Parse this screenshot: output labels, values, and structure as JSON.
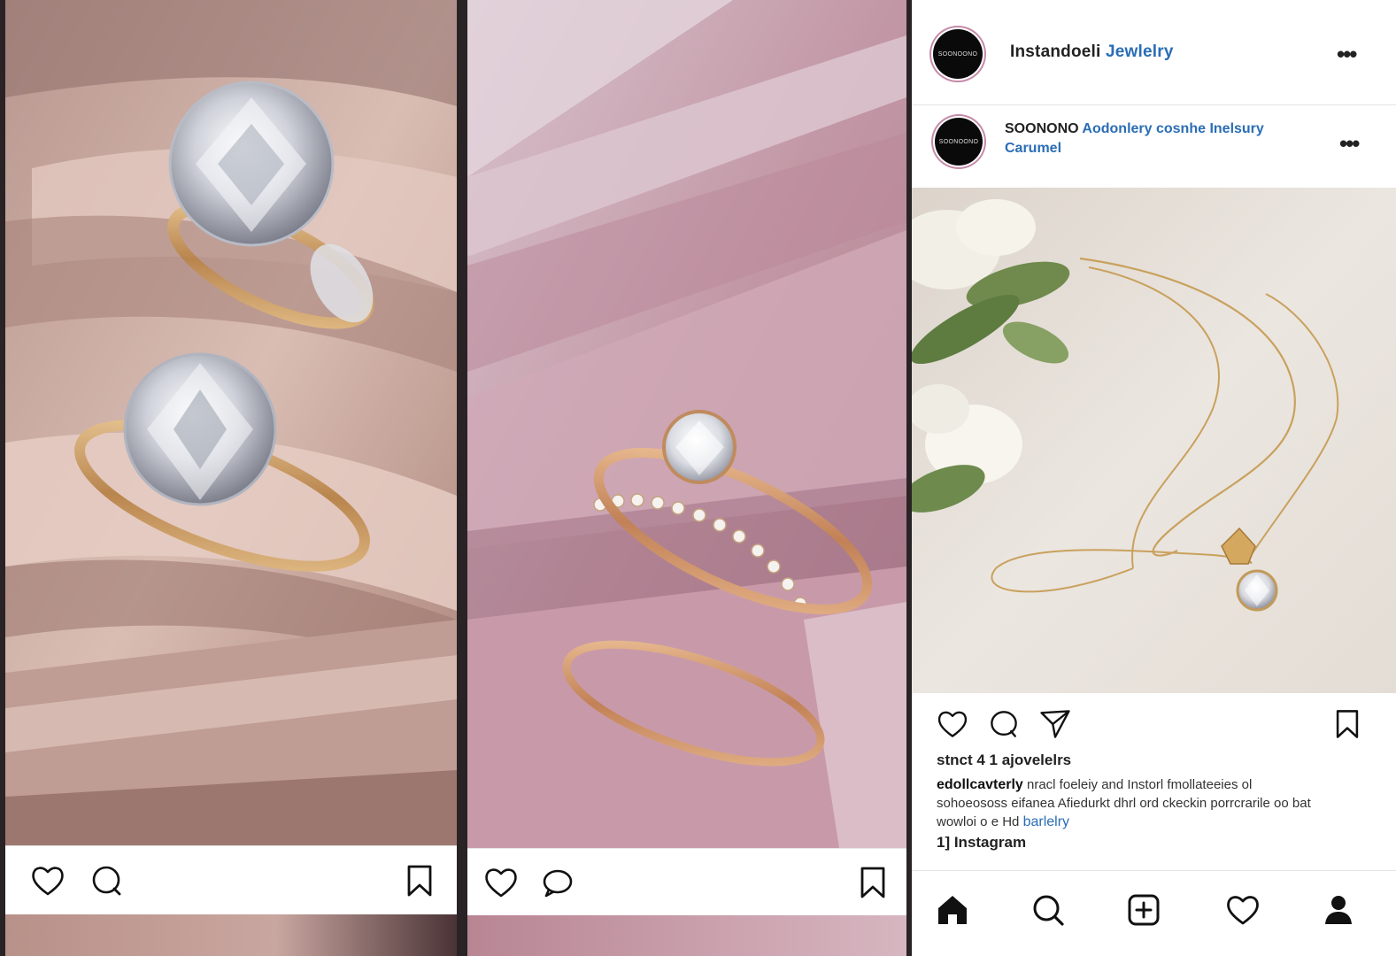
{
  "panels": [
    {
      "photo_alt": "Two diamond solitaire rings in a blush velvet box",
      "actions": [
        "heart-icon",
        "comment-icon",
        "bookmark-icon"
      ]
    },
    {
      "photo_alt": "Rose gold solitaire ring with diamond band in a pink velvet box",
      "actions": [
        "heart-icon",
        "comment-icon",
        "bookmark-icon"
      ]
    }
  ],
  "profile": {
    "avatar_text": "SOONOONO",
    "name_plain": "Instandoeli",
    "name_accent": "Jewlelry",
    "more_label": "•••"
  },
  "post": {
    "avatar_text": "SOONOONO",
    "title_plain": "SOONONO",
    "title_accent": "Aodonlery cosnhe Inelsury",
    "subtitle": "Carumel",
    "more_label": "•••",
    "likes": "stnct 4 1 ajovelelrs",
    "caption_user": "edollcavterly",
    "caption_line1": "nracl foeleiy and Instorl fmollateeies ol",
    "caption_line2": "sohoeososs eifanea Afiedurkt dhrl ord ckeckin porrcrarile oo bat",
    "caption_line3": "wowloi o e Hd",
    "caption_link": "barlelry",
    "time": "1] Instagram"
  },
  "tabs": [
    "home-icon",
    "search-icon",
    "new-post-icon",
    "activity-icon",
    "profile-icon"
  ],
  "colors": {
    "accent_blue": "#2a6db5",
    "velvet_blush": "#c9ada4",
    "velvet_pink": "#c99fab",
    "gold": "#c99a5b"
  }
}
